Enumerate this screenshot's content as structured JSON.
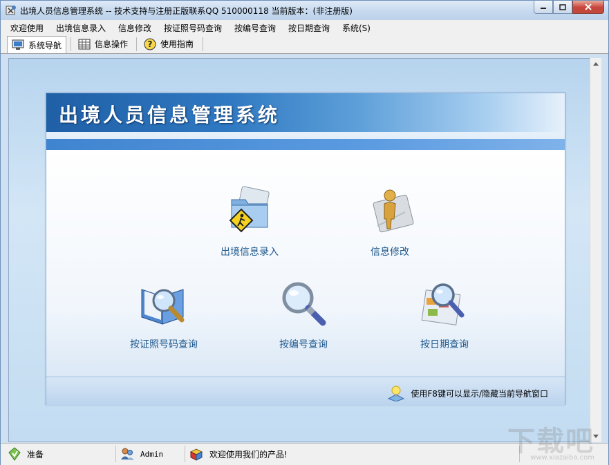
{
  "window": {
    "title": "出境人员信息管理系统 -- 技术支持与注册正版联系QQ 510000118    当前版本：(非注册版)"
  },
  "menu": {
    "items": [
      "欢迎使用",
      "出境信息录入",
      "信息修改",
      "按证照号码查询",
      "按编号查询",
      "按日期查询",
      "系统(S)"
    ]
  },
  "toolbar": {
    "tabs": [
      {
        "label": "系统导航",
        "icon": "monitor-icon",
        "active": true
      },
      {
        "label": "信息操作",
        "icon": "grid-icon",
        "active": false
      },
      {
        "label": "使用指南",
        "icon": "help-icon",
        "active": false
      }
    ]
  },
  "panel": {
    "title": "出境人员信息管理系统",
    "items": [
      {
        "label": "出境信息录入",
        "icon": "folder-person-icon"
      },
      {
        "label": "信息修改",
        "icon": "person-doc-icon"
      },
      {
        "label": "按证照号码查询",
        "icon": "book-search-icon"
      },
      {
        "label": "按编号查询",
        "icon": "magnifier-icon"
      },
      {
        "label": "按日期查询",
        "icon": "calendar-search-icon"
      }
    ],
    "tip": "使用F8键可以显示/隐藏当前导航窗口"
  },
  "status": {
    "ready": "准备",
    "user": "Admin",
    "welcome": "欢迎使用我们的产品!"
  },
  "watermark": {
    "text": "下载吧",
    "sub": "www.xiazaiba.com"
  },
  "colors": {
    "banner_dark": "#1f5fa6",
    "label_blue": "#215b8f",
    "client_bg": "#c3dcf1"
  }
}
